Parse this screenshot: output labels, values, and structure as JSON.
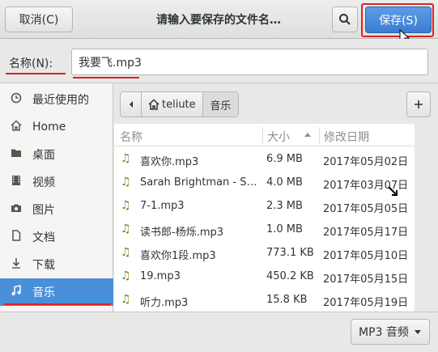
{
  "header": {
    "cancel_label": "取消(C)",
    "title": "请输入要保存的文件名…",
    "save_label": "保存(S)"
  },
  "name_row": {
    "label": "名称(N):",
    "value": "我要飞.mp3"
  },
  "sidebar": {
    "items": [
      {
        "label": "最近使用的",
        "icon": "clock-icon"
      },
      {
        "label": "Home",
        "icon": "home-icon"
      },
      {
        "label": "桌面",
        "icon": "folder-icon"
      },
      {
        "label": "视频",
        "icon": "video-icon"
      },
      {
        "label": "图片",
        "icon": "camera-icon"
      },
      {
        "label": "文档",
        "icon": "document-icon"
      },
      {
        "label": "下载",
        "icon": "download-icon"
      },
      {
        "label": "音乐",
        "icon": "music-icon",
        "active": true
      }
    ]
  },
  "path": {
    "home_label": "teliute",
    "current_label": "音乐"
  },
  "columns": {
    "name": "名称",
    "size": "大小",
    "modified": "修改日期"
  },
  "files": [
    {
      "name": "喜欢你.mp3",
      "size": "6.9 MB",
      "date": "2017年05月02日"
    },
    {
      "name": "Sarah Brightman - S…",
      "size": "4.0 MB",
      "date": "2017年03月07日"
    },
    {
      "name": "7-1.mp3",
      "size": "2.3 MB",
      "date": "2017年05月05日"
    },
    {
      "name": "读书郎-杨烁.mp3",
      "size": "1.0 MB",
      "date": "2017年05月17日"
    },
    {
      "name": "喜欢你1段.mp3",
      "size": "773.1 KB",
      "date": "2017年05月10日"
    },
    {
      "name": "19.mp3",
      "size": "450.2 KB",
      "date": "2017年05月15日"
    },
    {
      "name": "听力.mp3",
      "size": "15.8 KB",
      "date": "2017年05月19日"
    }
  ],
  "footer": {
    "filter_label": "MP3 音频"
  },
  "colors": {
    "accent": "#4a90d9",
    "highlight": "#e02020"
  }
}
